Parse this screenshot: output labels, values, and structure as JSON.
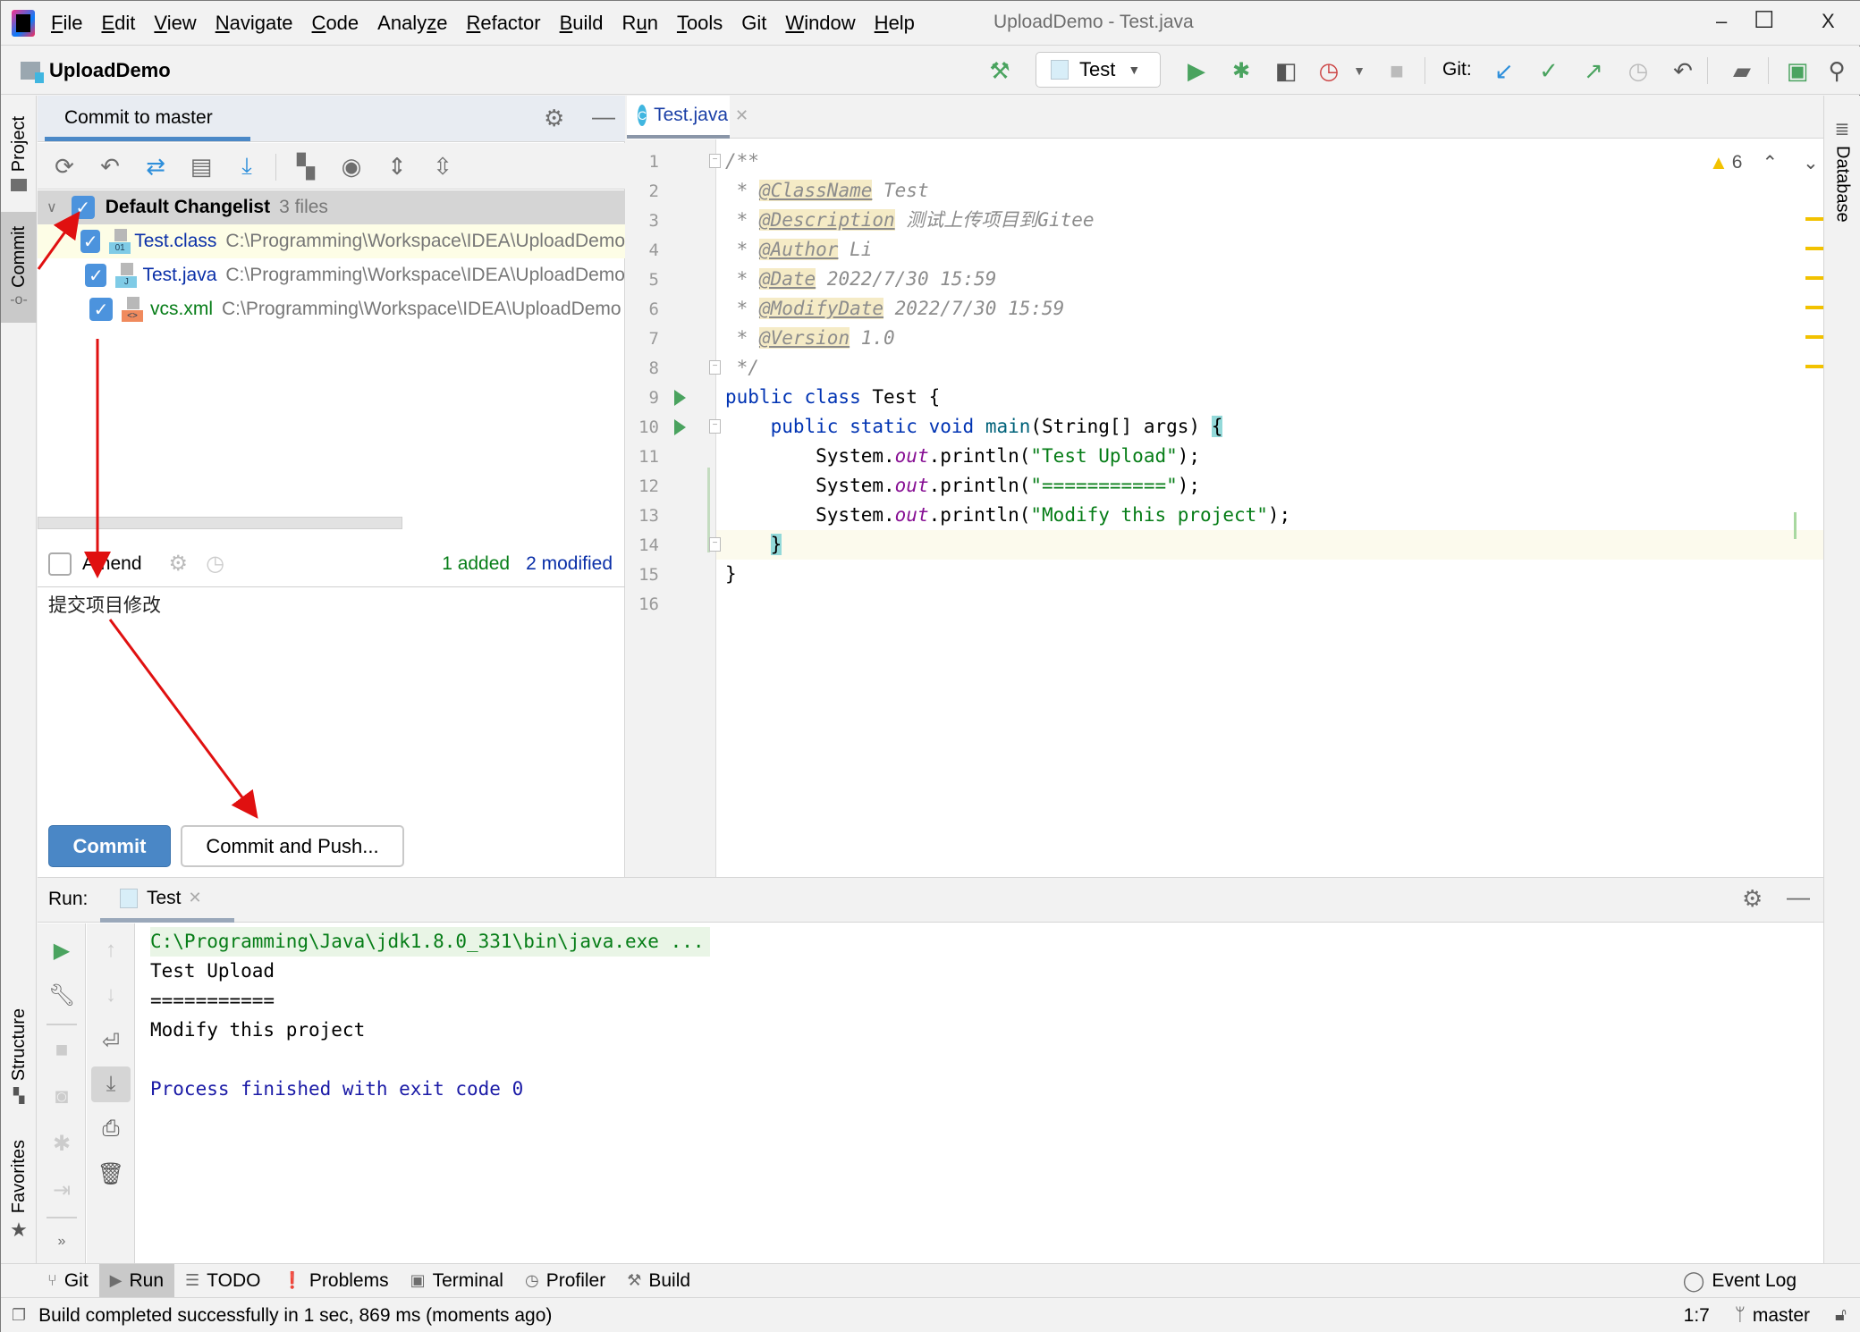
{
  "window": {
    "title": "UploadDemo - Test.java",
    "controls": {
      "minimize": "–",
      "maximize": "☐",
      "close": "X"
    }
  },
  "menubar": {
    "items": [
      {
        "label": "File",
        "mnemonic": "F"
      },
      {
        "label": "Edit",
        "mnemonic": "E"
      },
      {
        "label": "View",
        "mnemonic": "V"
      },
      {
        "label": "Navigate",
        "mnemonic": "N"
      },
      {
        "label": "Code",
        "mnemonic": "C"
      },
      {
        "label": "Analyze",
        "mnemonic": "z"
      },
      {
        "label": "Refactor",
        "mnemonic": "R"
      },
      {
        "label": "Build",
        "mnemonic": "B"
      },
      {
        "label": "Run",
        "mnemonic": "u"
      },
      {
        "label": "Tools",
        "mnemonic": "T"
      },
      {
        "label": "Git",
        "mnemonic": ""
      },
      {
        "label": "Window",
        "mnemonic": "W"
      },
      {
        "label": "Help",
        "mnemonic": "H"
      }
    ]
  },
  "navbar": {
    "project_name": "UploadDemo",
    "run_config": "Test",
    "git_label": "Git:"
  },
  "left_stripe": {
    "tabs": [
      {
        "label": "Project"
      },
      {
        "label": "Commit"
      },
      {
        "label": "Structure"
      },
      {
        "label": "Favorites"
      }
    ]
  },
  "right_stripe": {
    "tabs": [
      {
        "label": "Database"
      }
    ]
  },
  "commit_panel": {
    "title": "Commit to master",
    "changelist": {
      "name": "Default Changelist",
      "count": "3 files",
      "files": [
        {
          "name": "Test.class",
          "path": "C:\\Programming\\Workspace\\IDEA\\UploadDemo",
          "status": "modified",
          "type_label": "01",
          "color": "#0a2fa8"
        },
        {
          "name": "Test.java",
          "path": "C:\\Programming\\Workspace\\IDEA\\UploadDemo",
          "status": "modified",
          "type_label": "J",
          "color": "#0a2fa8"
        },
        {
          "name": "vcs.xml",
          "path": "C:\\Programming\\Workspace\\IDEA\\UploadDemo",
          "status": "added",
          "type_label": "<>",
          "color": "#067d17"
        }
      ]
    },
    "amend_label": "Amend",
    "summary": {
      "added": "1 added",
      "modified": "2 modified"
    },
    "message": "提交项目修改",
    "commit_button": "Commit",
    "commit_push_button": "Commit and Push..."
  },
  "editor": {
    "tab": {
      "label": "Test.java",
      "icon_letter": "C"
    },
    "warnings_count": "6",
    "current_line": 14,
    "lines": [
      {
        "n": "1",
        "html": "<span class='cm'>/**</span>"
      },
      {
        "n": "2",
        "html": "<span class='cm'> * </span><span class='tag'>@ClassName</span><span class='cm'> Test</span>"
      },
      {
        "n": "3",
        "html": "<span class='cm'> * </span><span class='tag'>@Description</span><span class='cm'> 测试上传项目到Gitee</span>"
      },
      {
        "n": "4",
        "html": "<span class='cm'> * </span><span class='tag'>@Author</span><span class='cm'> Li</span>"
      },
      {
        "n": "5",
        "html": "<span class='cm'> * </span><span class='tag'>@Date</span><span class='cm'> 2022/7/30 15:59</span>"
      },
      {
        "n": "6",
        "html": "<span class='cm'> * </span><span class='tag'>@ModifyDate</span><span class='cm'> 2022/7/30 15:59</span>"
      },
      {
        "n": "7",
        "html": "<span class='cm'> * </span><span class='tag'>@Version</span><span class='cm'> 1.0</span>"
      },
      {
        "n": "8",
        "html": "<span class='cm'> */</span>"
      },
      {
        "n": "9",
        "html": "<span class='kw'>public class</span> Test {"
      },
      {
        "n": "10",
        "html": "    <span class='kw'>public static void</span> <span class='fn'>main</span>(String[] args) <span class='brace-hl'>{</span>"
      },
      {
        "n": "11",
        "html": "        System.<span class='fld'>out</span>.println(<span class='st'>\"Test Upload\"</span>);"
      },
      {
        "n": "12",
        "html": "        System.<span class='fld'>out</span>.println(<span class='st'>\"===========\"</span>);"
      },
      {
        "n": "13",
        "html": "        System.<span class='fld'>out</span>.println(<span class='st'>\"Modify this project\"</span>);"
      },
      {
        "n": "14",
        "html": "    <span class='brace-hl'>}</span>"
      },
      {
        "n": "15",
        "html": "}"
      },
      {
        "n": "16",
        "html": ""
      }
    ]
  },
  "run_panel": {
    "label": "Run:",
    "tab": "Test",
    "console": [
      {
        "text": "C:\\Programming\\Java\\jdk1.8.0_331\\bin\\java.exe ...",
        "kind": "cmd"
      },
      {
        "text": "Test Upload",
        "kind": "out"
      },
      {
        "text": "===========",
        "kind": "out"
      },
      {
        "text": "Modify this project",
        "kind": "out"
      },
      {
        "text": "",
        "kind": "out"
      },
      {
        "text": "Process finished with exit code 0",
        "kind": "sys"
      }
    ]
  },
  "tool_tabs": [
    {
      "label": "Git",
      "icon": "git-icon"
    },
    {
      "label": "Run",
      "icon": "run-icon",
      "active": true
    },
    {
      "label": "TODO",
      "icon": "list-icon"
    },
    {
      "label": "Problems",
      "icon": "problems-icon"
    },
    {
      "label": "Terminal",
      "icon": "terminal-icon"
    },
    {
      "label": "Profiler",
      "icon": "profiler-icon"
    },
    {
      "label": "Build",
      "icon": "hammer-icon"
    }
  ],
  "event_log": "Event Log",
  "status_bar": {
    "message": "Build completed successfully in 1 sec, 869 ms (moments ago)",
    "position": "1:7",
    "branch": "master"
  },
  "colors": {
    "accent": "#4a87c6",
    "run_green": "#4aa35f",
    "added_green": "#067d17",
    "modified_blue": "#0a2fa8",
    "warning": "#f2c200",
    "annotation_red": "#e01010"
  }
}
